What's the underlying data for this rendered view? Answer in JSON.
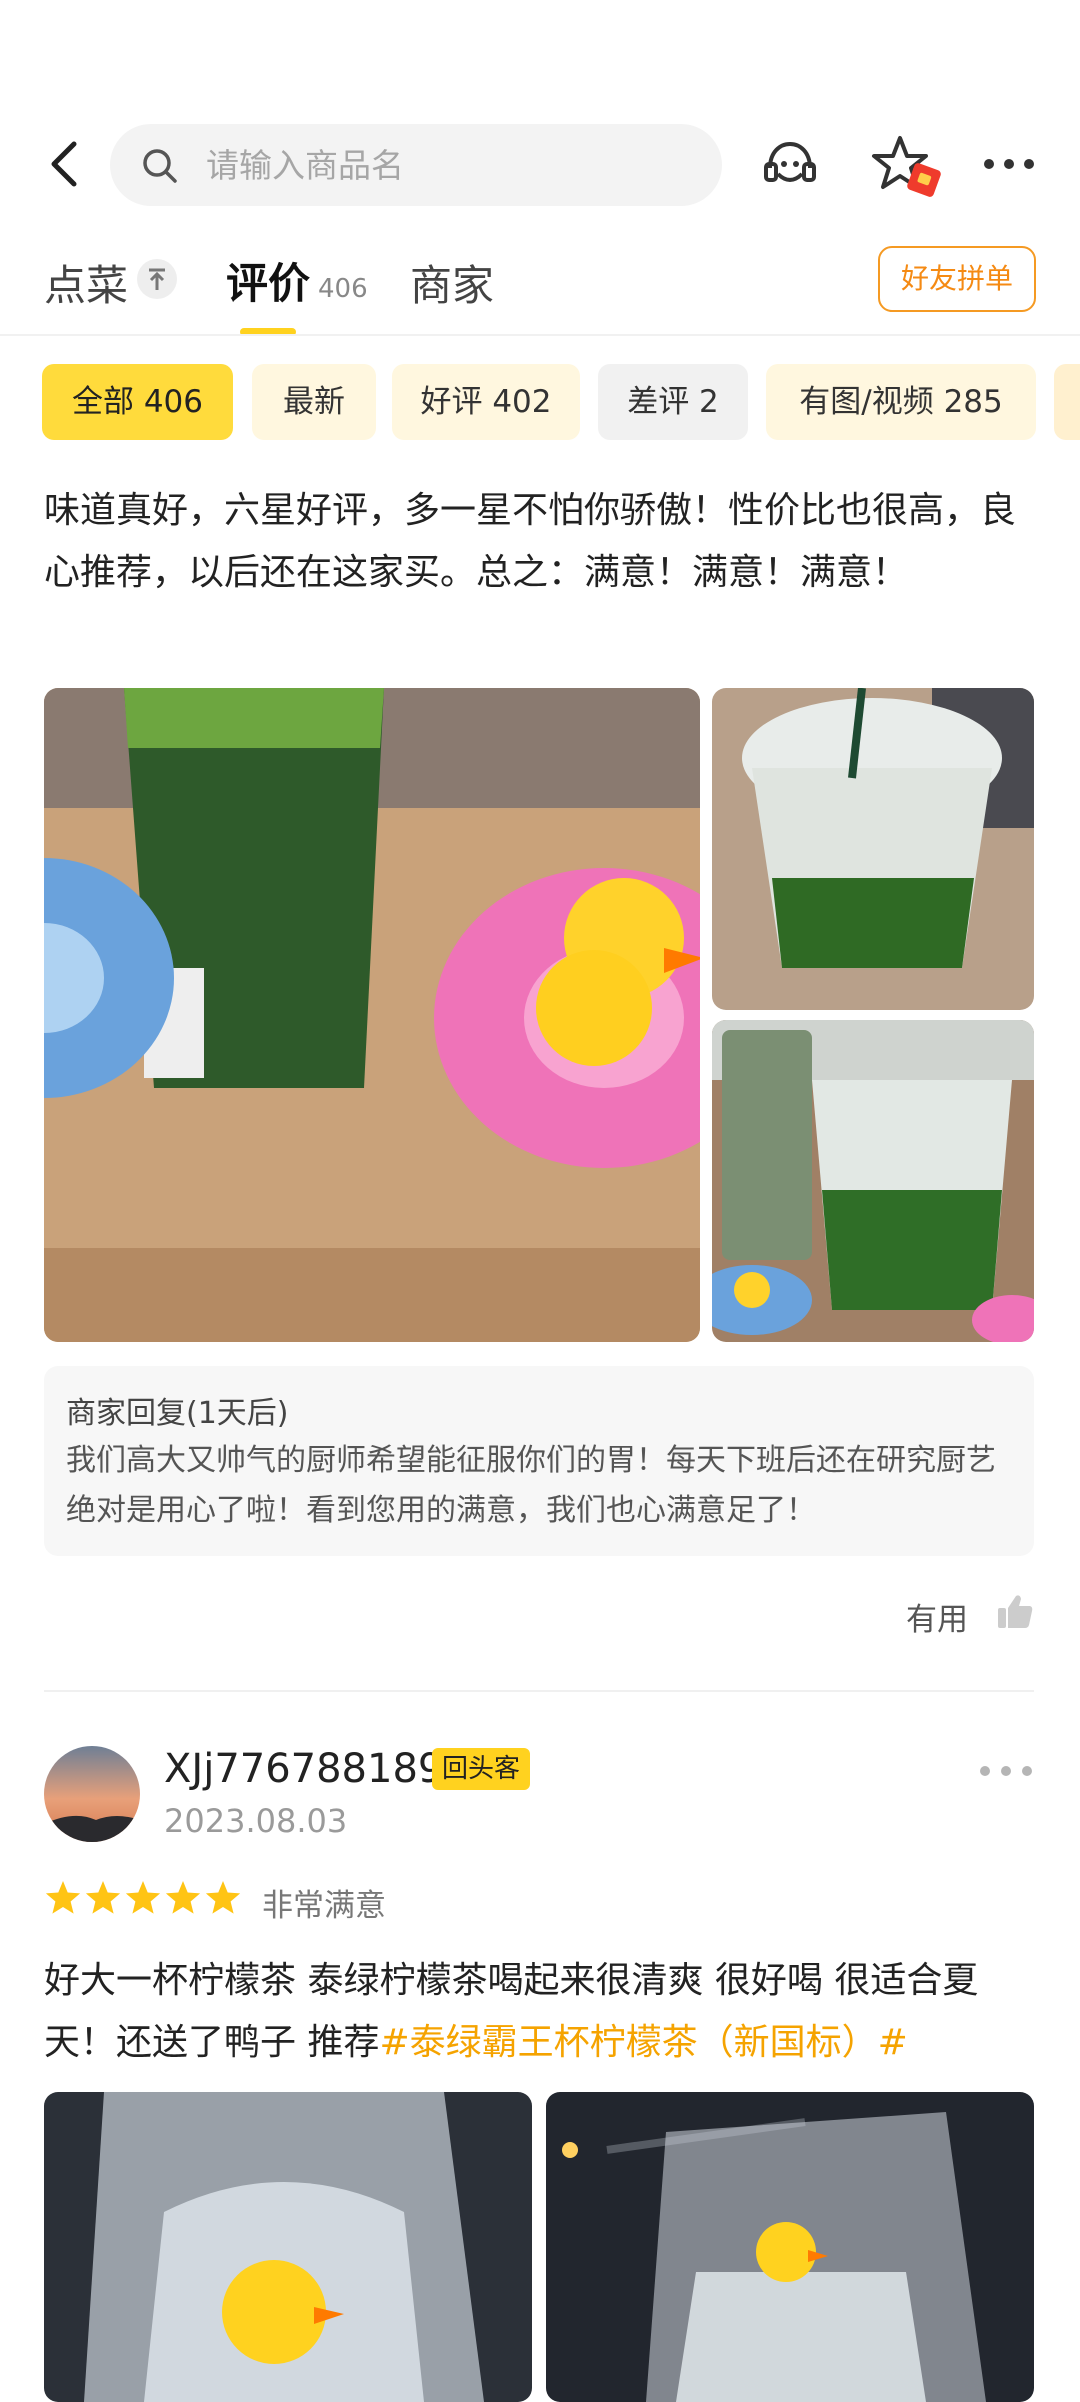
{
  "header": {
    "search_placeholder": "请输入商品名",
    "icons": [
      "back-icon",
      "search-icon",
      "customer-service-icon",
      "favorite-star-icon",
      "red-packet-badge-icon",
      "more-icon"
    ]
  },
  "tabs": {
    "menu": "点菜",
    "reviews": "评价",
    "reviews_count": "406",
    "merchant": "商家",
    "group_order": "好友拼单"
  },
  "filters": {
    "all": "全部 406",
    "latest": "最新",
    "good": "好评 402",
    "bad": "差评 2",
    "media": "有图/视频 285"
  },
  "review1": {
    "text": "味道真好，六星好评，多一星不怕你骄傲！性价比也很高，良心推荐，以后还在这家买。总之：满意！满意！满意！",
    "reply_title": "商家回复(1天后)",
    "reply_text": "我们高大又帅气的厨师希望能征服你们的胃！每天下班后还在研究厨艺绝对是用心了啦！看到您用的满意，我们也心满意足了！",
    "useful": "有用"
  },
  "review2": {
    "username": "XJj776788189",
    "badge": "回头客",
    "date": "2023.08.03",
    "rating": 5,
    "rating_text": "非常满意",
    "text": "好大一杯柠檬茶 泰绿柠檬茶喝起来很清爽 很好喝 很适合夏天！还送了鸭子 推荐",
    "hashtag": "#泰绿霸王杯柠檬茶（新国标）#"
  },
  "colors": {
    "accent_yellow": "#ffd21f",
    "chip_bg": "#fff7df",
    "orange": "#f58a13",
    "hashtag": "#f5a300"
  }
}
